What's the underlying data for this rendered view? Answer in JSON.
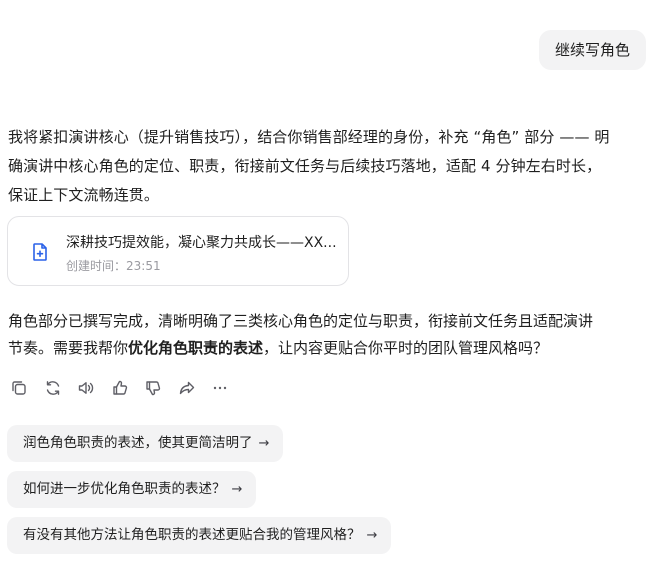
{
  "user_message": {
    "text": "继续写角色"
  },
  "assistant": {
    "intro_lines": [
      "我将紧扣演讲核心（提升销售技巧），结合你销售部经理的身份，补充 “角色” 部分 —— 明",
      "确演讲中核心角色的定位、职责，衔接前文任务与后续技巧落地，适配 4 分钟左右时长，",
      "保证上下文流畅连贯。"
    ],
    "document": {
      "title": "深耕技巧提效能，凝心聚力共成长——XX...",
      "created_label": "创建时间：",
      "created_time": "23:51",
      "icon": "document-icon"
    },
    "summary": {
      "line1": "角色部分已撰写完成，清晰明确了三类核心角色的定位与职责，衔接前文任务且适配演讲",
      "line2_prefix": "节奏。需要我帮你",
      "line2_bold": "优化角色职责的表述",
      "line2_suffix": "，让内容更贴合你平时的团队管理风格吗？"
    },
    "actions": [
      {
        "name": "copy-icon"
      },
      {
        "name": "regenerate-icon"
      },
      {
        "name": "read-aloud-icon"
      },
      {
        "name": "thumbs-up-icon"
      },
      {
        "name": "thumbs-down-icon"
      },
      {
        "name": "share-icon"
      },
      {
        "name": "more-icon"
      }
    ]
  },
  "suggestions": [
    {
      "text": "润色角色职责的表述，使其更简洁明了",
      "arrow": "→"
    },
    {
      "text": "如何进一步优化角色职责的表述？",
      "arrow": "→"
    },
    {
      "text": "有没有其他方法让角色职责的表述更贴合我的管理风格？",
      "arrow": "→"
    }
  ],
  "colors": {
    "bubble_bg": "#f3f3f4",
    "icon_blue": "#2b62e8",
    "muted_text": "#9a9aa0"
  }
}
